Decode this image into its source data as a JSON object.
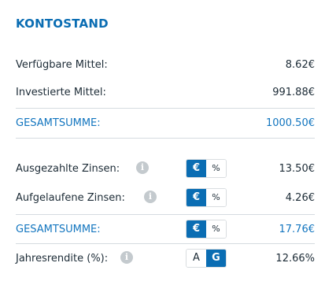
{
  "panel": {
    "title": "KONTOSTAND"
  },
  "balance": {
    "available": {
      "label": "Verfügbare Mittel:",
      "value": "8.62€"
    },
    "invested": {
      "label": "Investierte Mittel:",
      "value": "991.88€"
    },
    "total": {
      "label": "GESAMTSUMME:",
      "value": "1000.50€"
    }
  },
  "interest": {
    "paid": {
      "label": "Ausgezahlte Zinsen:",
      "value": "13.50€",
      "unit_options": [
        "€",
        "%"
      ],
      "selected": "€"
    },
    "accrued": {
      "label": "Aufgelaufene Zinsen:",
      "value": "4.26€",
      "unit_options": [
        "€",
        "%"
      ],
      "selected": "€"
    },
    "total": {
      "label": "GESAMTSUMME:",
      "value": "17.76€",
      "unit_options": [
        "€",
        "%"
      ],
      "selected": "€"
    },
    "annual_return": {
      "label": "Jahresrendite (%):",
      "value": "12.66%",
      "mode_options": [
        "A",
        "G"
      ],
      "selected": "G"
    }
  },
  "icons": {
    "info": "info-icon"
  },
  "colors": {
    "accent": "#0a6db3",
    "sum_text": "#1275bf",
    "divider": "#d5dbe0",
    "info_icon": "#c4cace"
  }
}
